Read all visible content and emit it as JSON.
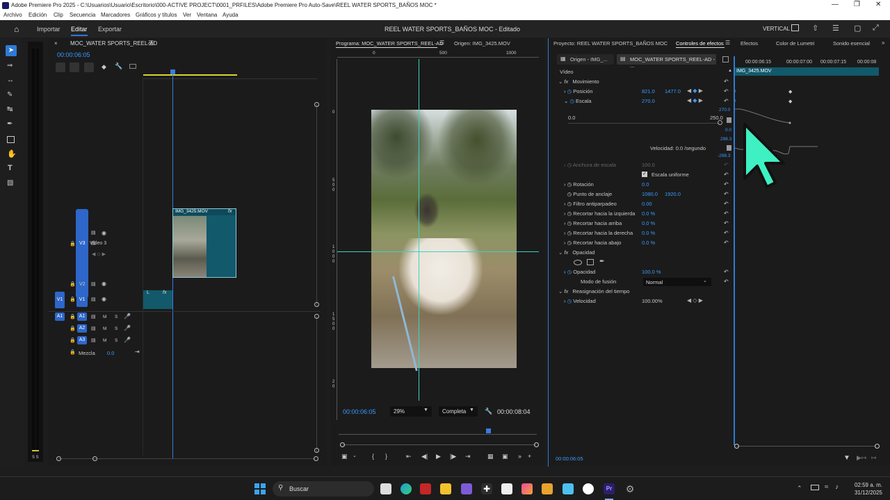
{
  "window": {
    "title": "Adobe Premiere Pro 2025 - C:\\Usuarios\\Usuario\\Escritorio\\000-ACTIVE PROJECT\\0001_PRFILES\\Adobe Premiere Pro Auto-Save\\REEL WATER SPORTS_BAÑOS MOC *"
  },
  "menu": [
    "Archivo",
    "Edición",
    "Clip",
    "Secuencia",
    "Marcadores",
    "Gráficos y títulos",
    "Ver",
    "Ventana",
    "Ayuda"
  ],
  "workspace": {
    "tabs": [
      "Importar",
      "Editar",
      "Exportar"
    ],
    "project_title": "REEL WATER SPORTS_BAÑOS MOC - Editado",
    "layout": "VERTICAL"
  },
  "timeline": {
    "seq_name": "MOC_WATER SPORTS_REEL-AD",
    "timecode": "00:00:06:05",
    "clip_name": "IMG_3425.MOV",
    "fx": "fx",
    "v1_clip": "L",
    "tracks": {
      "v3": "V3",
      "v3_name": "Vídeo 3",
      "v2": "V2",
      "v1": "V1",
      "v1_src": "V1",
      "a1": "A1",
      "a1_src": "A1",
      "a2": "A2",
      "a3": "A3",
      "mezcla": "Mezcla",
      "mezcla_val": "0.0",
      "m": "M",
      "s": "S"
    }
  },
  "program": {
    "tab": "Programa: MOC_WATER SPORTS_REEL-AD",
    "origin": "Origen: IMG_3425.MOV",
    "ruler": [
      "0",
      "500",
      "1000"
    ],
    "vruler": [
      "0",
      "5 0 0",
      "1 0 0 0",
      "1 5 0 0",
      "2 0"
    ],
    "timecode": "00:00:06:05",
    "zoom": "29%",
    "quality": "Completa",
    "duration": "00:00:08:04"
  },
  "effects": {
    "tabs": [
      "Proyecto: REEL WATER SPORTS_BAÑOS MOC",
      "Controles de efectos",
      "Efectos",
      "Color de Lumetri",
      "Sonido esencial"
    ],
    "src_tab": "Origen - IMG_...",
    "seq_tab": "MOC_WATER SPORTS_REEL-AD - ...",
    "section": "Vídeo",
    "motion": "Movimiento",
    "position": "Posición",
    "pos_x": "821.0",
    "pos_y": "1477.0",
    "scale": "Escala",
    "scale_val": "270.0",
    "graph_left": "0.0",
    "graph_right": "250.0",
    "graph_top": "270.0",
    "graph_zero": "0.0",
    "vel_top": "298.3",
    "vel_bottom": "-298.3",
    "velocity": "Velocidad: 0.0 /segundo",
    "scale_width": "Anchura de escala",
    "scale_width_val": "100.0",
    "uniform": "Escala uniforme",
    "rotation": "Rotación",
    "rotation_val": "0.0",
    "anchor": "Punto de anclaje",
    "anchor_x": "1080.0",
    "anchor_y": "1920.0",
    "antiflicker": "Filtro antiparpadeo",
    "antiflicker_val": "0.00",
    "crop_left": "Recortar hacia la izquierda",
    "crop_top": "Recortar hacia arriba",
    "crop_right": "Recortar hacia la derecha",
    "crop_bottom": "Recortar hacia abajo",
    "crop_val": "0.0 %",
    "opacity_sec": "Opacidad",
    "opacity": "Opacidad",
    "opacity_val": "100.0 %",
    "blend": "Modo de fusión",
    "blend_val": "Normal",
    "remap": "Reasignación del tiempo",
    "speed": "Velocidad",
    "speed_val": "100.00%",
    "ruler": [
      "00:00:06:15",
      "00:00:07:00",
      "00:00:07:15",
      "00:00:08"
    ],
    "clip": "IMG_3425.MOV",
    "timecode": "00:00:06:05"
  },
  "taskbar": {
    "search": "Buscar",
    "time": "02:59 a. m.",
    "date": "31/12/2025"
  },
  "colors": {
    "accent": "#2e7bd6",
    "cursor": "#3ef0c2",
    "clip": "#12596b",
    "guide": "#3ad4c4"
  }
}
